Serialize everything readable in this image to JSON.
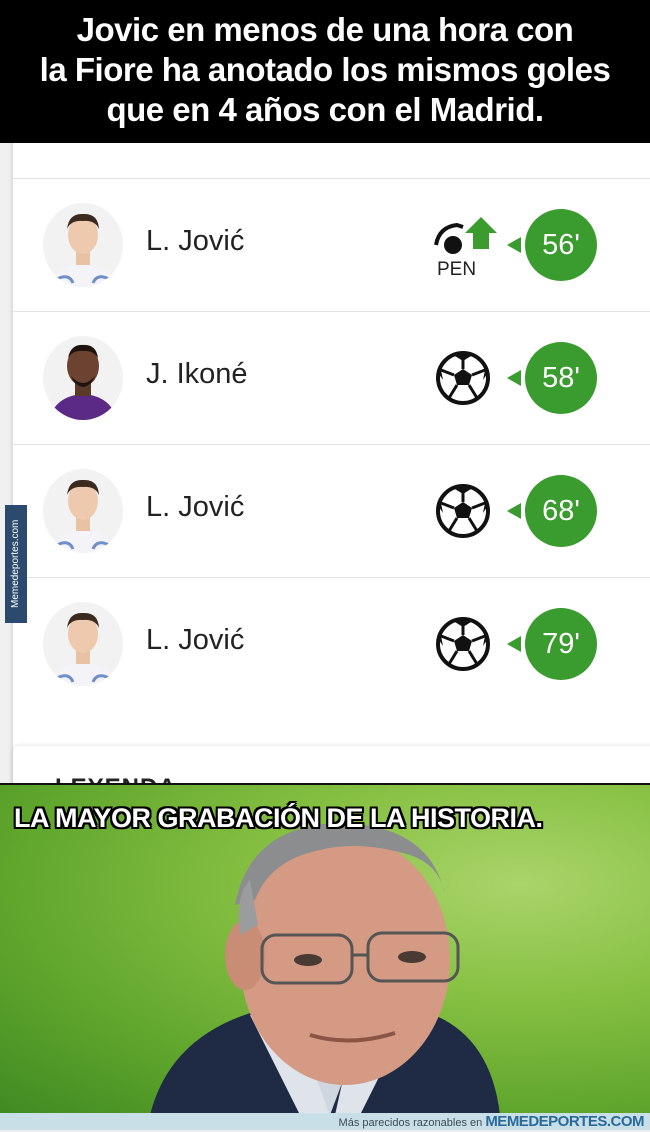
{
  "top_caption": {
    "line1": "Jovic en menos de una hora con",
    "line2": "la Fiore ha anotado los mismos goles",
    "line3": "que en 4 años con el Madrid."
  },
  "events": [
    {
      "player": "L. Jović",
      "event_icon": "penalty-goal-icon",
      "event_label": "PEN",
      "minute": "56'"
    },
    {
      "player": "J. Ikoné",
      "event_icon": "soccer-ball-icon",
      "minute": "58'"
    },
    {
      "player": "L. Jović",
      "event_icon": "soccer-ball-icon",
      "minute": "68'"
    },
    {
      "player": "L. Jović",
      "event_icon": "soccer-ball-icon",
      "minute": "79'"
    }
  ],
  "legend_title": "LEYENDA",
  "side_watermark": "Memedeportes.com",
  "photo_caption": "LA MAYOR GRABACIÓN DE LA HISTORIA.",
  "footer": {
    "prefix": "Más parecidos razonables en",
    "brand": "MEMEDEPORTES.COM"
  },
  "colors": {
    "minute_badge": "#3a9c2e",
    "caption_bg": "#000000",
    "photo_bg": "#7fbf3f"
  }
}
